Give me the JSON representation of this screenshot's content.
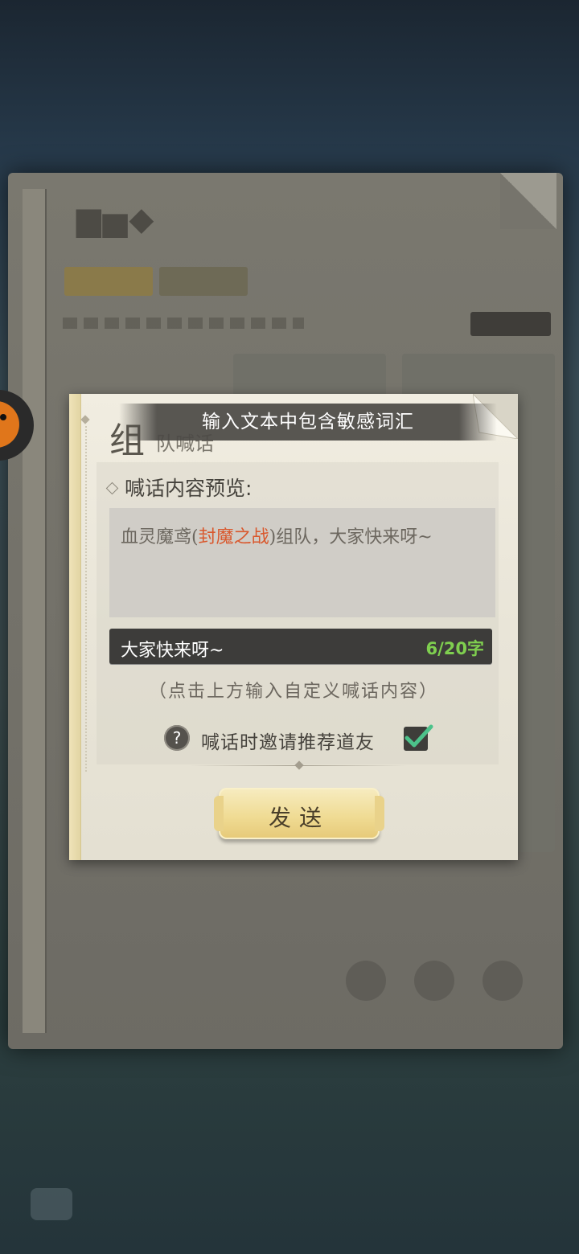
{
  "toast": "输入文本中包含敏感词汇",
  "dialog": {
    "title_big": "组",
    "title_small": "队喊话",
    "preview_label": "喊话内容预览:",
    "preview": {
      "part1": "血灵魔鸢(",
      "highlight": "封魔之战",
      "part2": ")组队，大家快来呀~",
      "highlight_color": "#d9582d"
    },
    "input": {
      "value": "大家快来呀~",
      "counter": "6/20字"
    },
    "hint": "（点击上方输入自定义喊话内容）",
    "invite": {
      "help_glyph": "?",
      "label": "喊话时邀请推荐道友",
      "checked": true
    },
    "send_label": "发送"
  }
}
